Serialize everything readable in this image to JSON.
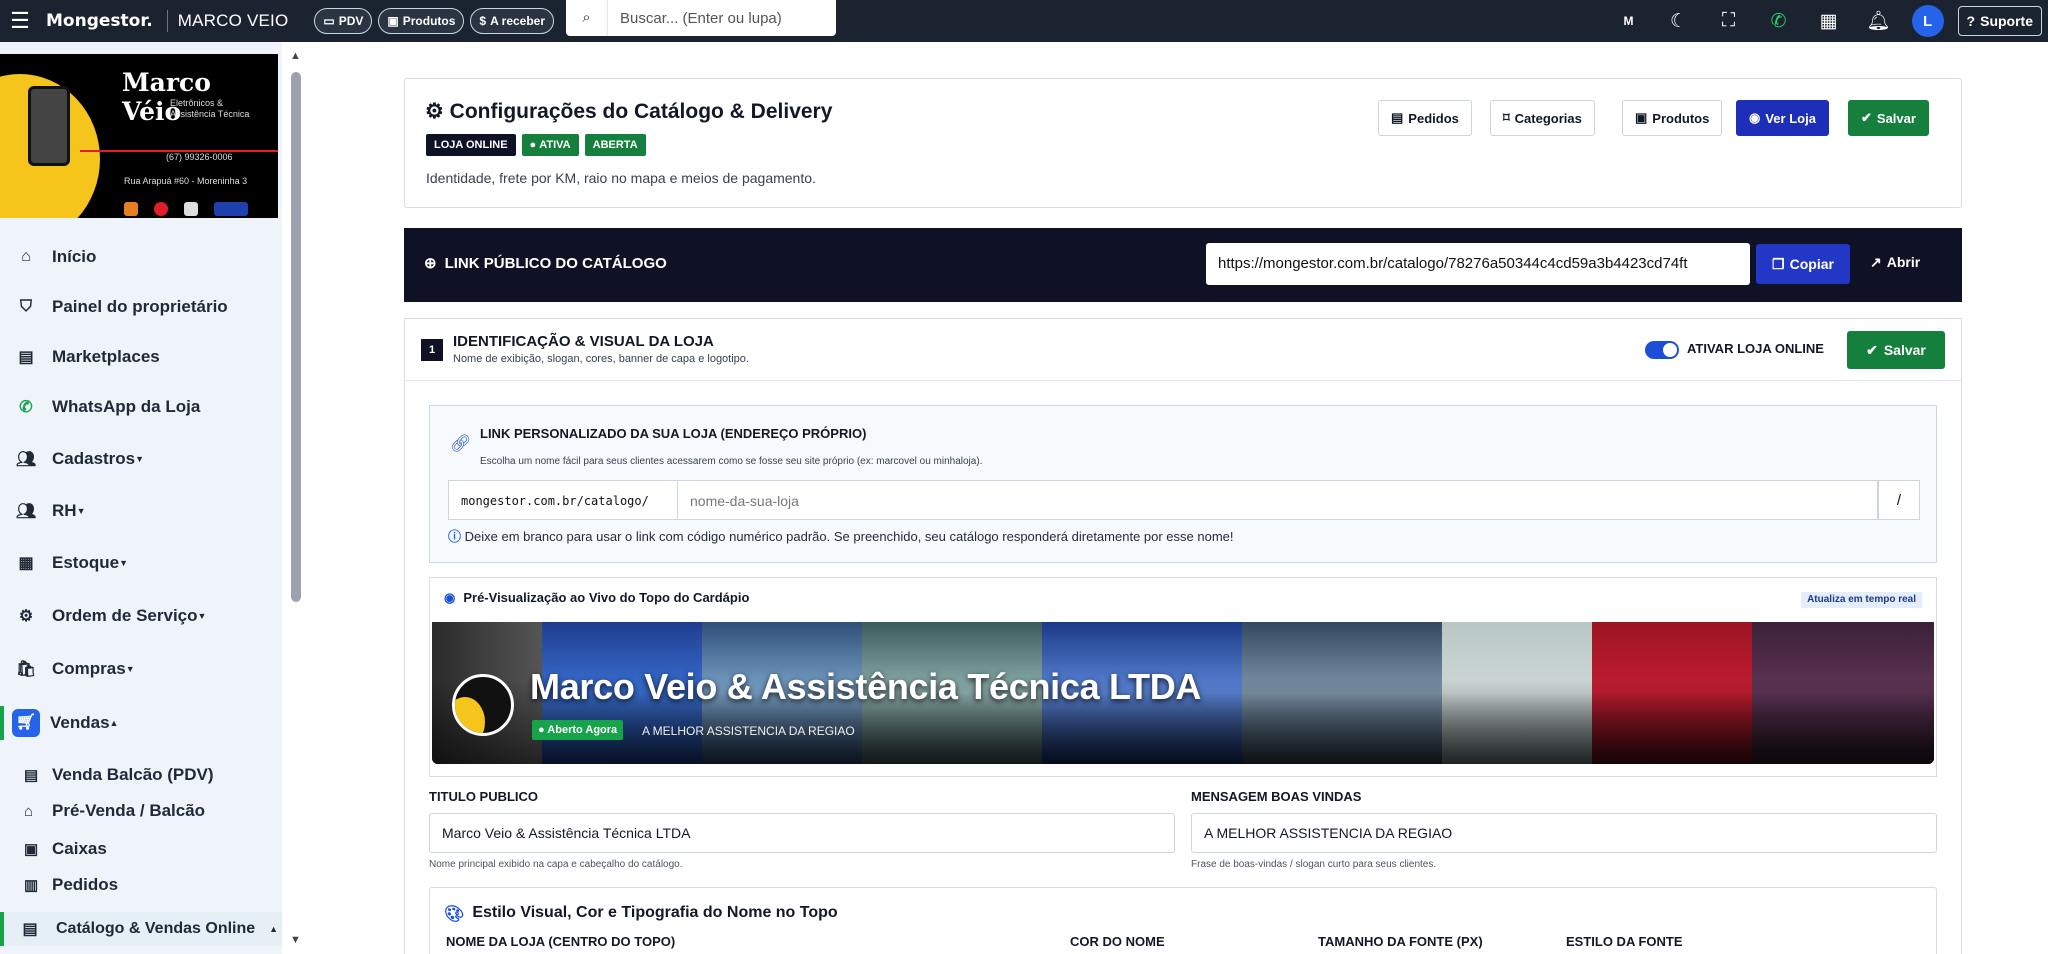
{
  "topbar": {
    "brand": "Mongestor.",
    "store": "MARCO VEIO",
    "pills": [
      {
        "label": "PDV",
        "icon": "monitor-icon"
      },
      {
        "label": "Produtos",
        "icon": "box-icon"
      },
      {
        "label": "A receber",
        "icon": "money-icon"
      }
    ],
    "search_placeholder": "Buscar... (Enter ou lupa)",
    "avatar": "L",
    "support": "Suporte"
  },
  "sidebar": {
    "logo": {
      "title": "Marco Véio",
      "subtitle": "Eletrônicos & Assistência Técnica",
      "phone": "(67) 99326-0006",
      "address": "Rua Arapuá #60 - Moreninha 3"
    },
    "items": [
      {
        "label": "Início",
        "icon": "home-icon"
      },
      {
        "label": "Painel do proprietário",
        "icon": "shield-icon"
      },
      {
        "label": "Marketplaces",
        "icon": "store-icon"
      },
      {
        "label": "WhatsApp da Loja",
        "icon": "whatsapp-icon"
      },
      {
        "label": "Cadastros",
        "icon": "users-icon"
      },
      {
        "label": "RH",
        "icon": "people-icon"
      },
      {
        "label": "Estoque",
        "icon": "boxes-icon"
      },
      {
        "label": "Ordem de Serviço",
        "icon": "wrench-icon"
      },
      {
        "label": "Compras",
        "icon": "bag-icon"
      },
      {
        "label": "Vendas",
        "icon": "cart-icon"
      }
    ],
    "subitems": [
      {
        "label": "Venda Balcão (PDV)",
        "icon": "register-icon"
      },
      {
        "label": "Pré-Venda / Balcão",
        "icon": "shop-icon"
      },
      {
        "label": "Caixas",
        "icon": "cash-icon"
      },
      {
        "label": "Pedidos",
        "icon": "orders-icon"
      }
    ],
    "last_item": "Catálogo & Vendas Online"
  },
  "header": {
    "title": "Configurações do Catálogo & Delivery",
    "badges": [
      "LOJA ONLINE",
      "ATIVA",
      "ABERTA"
    ],
    "subtitle": "Identidade, frete por KM, raio no mapa e meios de pagamento.",
    "buttons": [
      "Pedidos",
      "Categorias",
      "Produtos",
      "Ver Loja",
      "Salvar"
    ]
  },
  "public_link": {
    "title": "LINK PÚBLICO DO CATÁLOGO",
    "url": "https://mongestor.com.br/catalogo/78276a50344c4cd59a3b4423cd74ft",
    "copy": "Copiar",
    "open": "Abrir"
  },
  "section1": {
    "number": "1",
    "title": "IDENTIFICAÇÃO & VISUAL DA LOJA",
    "desc": "Nome de exibição, slogan, cores, banner de capa e logotipo.",
    "toggle_label": "ATIVAR LOJA ONLINE",
    "save": "Salvar"
  },
  "slug": {
    "title": "LINK PERSONALIZADO DA SUA LOJA (ENDEREÇO PRÓPRIO)",
    "desc": "Escolha um nome fácil para seus clientes acessarem como se fosse seu site próprio (ex: marcovel ou minhaloja).",
    "prefix": "mongestor.com.br/catalogo/",
    "placeholder": "nome-da-sua-loja",
    "suffix": "/",
    "hint": "Deixe em branco para usar o link com código numérico padrão. Se preenchido, seu catálogo responderá diretamente por esse nome!"
  },
  "preview": {
    "title": "Pré-Visualização ao Vivo do Topo do Cardápio",
    "realtime": "Atualiza em tempo real",
    "store_name": "Marco Veio & Assistência Técnica LTDA",
    "open_badge": "Aberto Agora",
    "slogan": "A MELHOR ASSISTENCIA DA REGIAO"
  },
  "fields": {
    "title_label": "TITULO PUBLICO",
    "title_value": "Marco Veio & Assistência Técnica LTDA",
    "title_help": "Nome principal exibido na capa e cabeçalho do catálogo.",
    "welcome_label": "MENSAGEM BOAS VINDAS",
    "welcome_value": "A MELHOR ASSISTENCIA DA REGIAO",
    "welcome_help": "Frase de boas-vindas / slogan curto para seus clientes."
  },
  "style": {
    "title": "Estilo Visual, Cor e Tipografia do Nome no Topo",
    "cols": [
      "NOME DA LOJA (CENTRO DO TOPO)",
      "COR DO NOME",
      "TAMANHO DA FONTE (PX)",
      "ESTILO DA FONTE"
    ]
  },
  "colors": {
    "dark": "#1c2330",
    "green": "#15803d",
    "blue": "#1d2fb8",
    "navy": "#0e1224"
  }
}
